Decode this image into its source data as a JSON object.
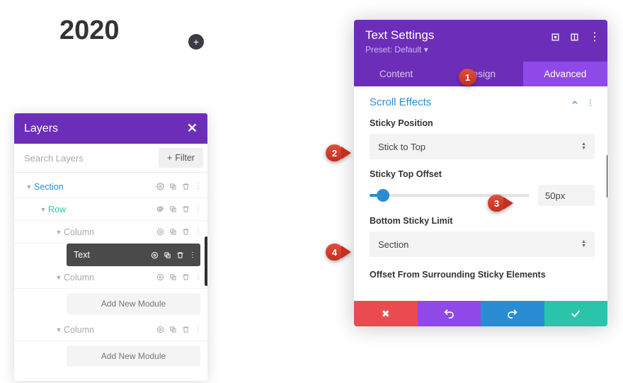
{
  "page": {
    "year": "2020",
    "add_icon": "+"
  },
  "layers": {
    "title": "Layers",
    "search_placeholder": "Search Layers",
    "filter_icon": "+",
    "filter_label": "Filter",
    "items": {
      "section": "Section",
      "row": "Row",
      "column": "Column",
      "text": "Text"
    },
    "add_module": "Add New Module"
  },
  "settings": {
    "title": "Text Settings",
    "preset": "Preset: Default ▾",
    "tabs": [
      "Content",
      "Design",
      "Advanced"
    ],
    "section": {
      "title": "Scroll Effects"
    },
    "fields": {
      "sticky_position": {
        "label": "Sticky Position",
        "value": "Stick to Top"
      },
      "sticky_top_offset": {
        "label": "Sticky Top Offset",
        "value": "50px"
      },
      "bottom_sticky_limit": {
        "label": "Bottom Sticky Limit",
        "value": "Section"
      },
      "offset_from": {
        "label": "Offset From Surrounding Sticky Elements"
      }
    }
  },
  "callouts": {
    "c1": "1",
    "c2": "2",
    "c3": "3",
    "c4": "4"
  }
}
